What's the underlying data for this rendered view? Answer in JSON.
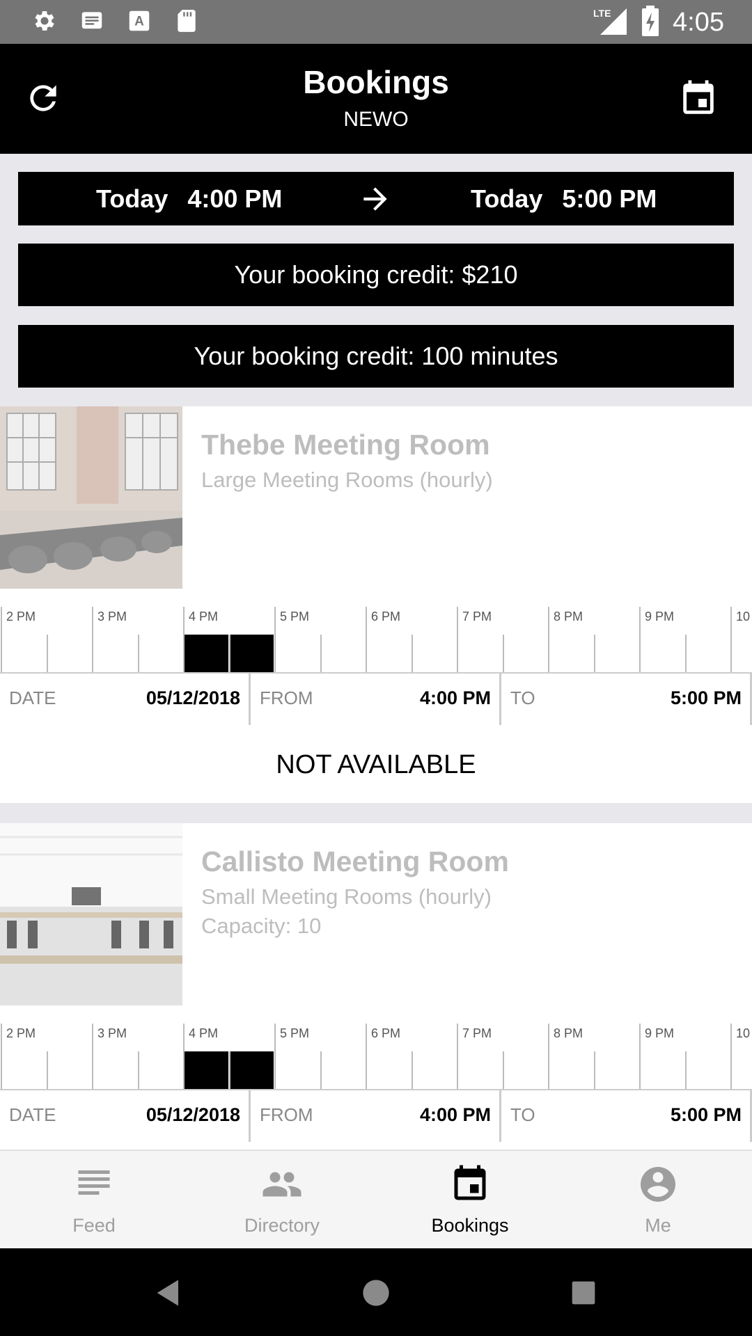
{
  "status_bar": {
    "time": "4:05",
    "network": "LTE",
    "left_icons": [
      "settings-icon",
      "message-icon",
      "font-icon",
      "sd-card-icon"
    ]
  },
  "header": {
    "title": "Bookings",
    "subtitle": "NEWO",
    "left_icon": "refresh-icon",
    "right_icon": "calendar-icon"
  },
  "time_range": {
    "start_day": "Today",
    "start_time": "4:00 PM",
    "end_day": "Today",
    "end_time": "5:00 PM"
  },
  "credits": {
    "money": "Your booking credit: $210",
    "minutes": "Your booking credit: 100 minutes"
  },
  "rooms": [
    {
      "name": "Thebe Meeting Room",
      "type": "Large Meeting Rooms (hourly)",
      "capacity": "",
      "timeline_hours": [
        "2 PM",
        "3 PM",
        "4 PM",
        "5 PM",
        "6 PM",
        "7 PM",
        "8 PM",
        "9 PM",
        "10"
      ],
      "selected_start_hour": 4,
      "selected_end_hour": 5,
      "date_label": "DATE",
      "date": "05/12/2018",
      "from_label": "FROM",
      "from": "4:00 PM",
      "to_label": "TO",
      "to": "5:00 PM",
      "status": "NOT AVAILABLE"
    },
    {
      "name": "Callisto Meeting Room",
      "type": "Small Meeting Rooms (hourly)",
      "capacity": "Capacity: 10",
      "timeline_hours": [
        "2 PM",
        "3 PM",
        "4 PM",
        "5 PM",
        "6 PM",
        "7 PM",
        "8 PM",
        "9 PM",
        "10"
      ],
      "selected_start_hour": 4,
      "selected_end_hour": 5,
      "date_label": "DATE",
      "date": "05/12/2018",
      "from_label": "FROM",
      "from": "4:00 PM",
      "to_label": "TO",
      "to": "5:00 PM",
      "status": ""
    }
  ],
  "bottom_nav": {
    "items": [
      {
        "label": "Feed",
        "icon": "feed-icon",
        "active": false
      },
      {
        "label": "Directory",
        "icon": "people-icon",
        "active": false
      },
      {
        "label": "Bookings",
        "icon": "calendar-icon",
        "active": true
      },
      {
        "label": "Me",
        "icon": "account-icon",
        "active": false
      }
    ]
  },
  "colors": {
    "primary": "#000000",
    "background": "#e8e8ec",
    "muted_text": "#bdbdbd",
    "status_bar": "#757575"
  }
}
